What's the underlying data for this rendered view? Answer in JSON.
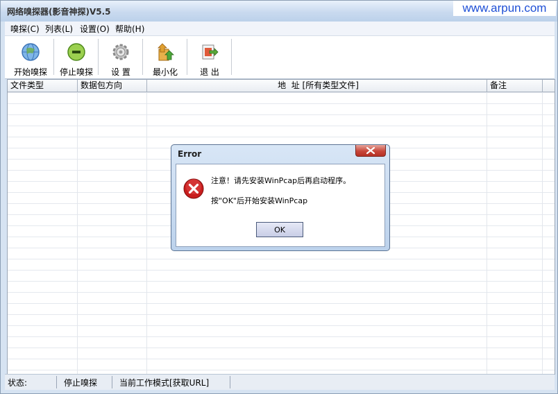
{
  "window": {
    "title": "网络嗅探器(影音神探)V5.5"
  },
  "brand": "www.arpun.com",
  "menu": [
    {
      "label": "嗅探(C)"
    },
    {
      "label": "列表(L)"
    },
    {
      "label": "设置(O)"
    },
    {
      "label": "帮助(H)"
    }
  ],
  "toolbar": [
    {
      "label": "开始嗅探",
      "icon": "globe-icon"
    },
    {
      "label": "停止嗅探",
      "icon": "stop-icon"
    },
    {
      "label": "设 置",
      "icon": "gear-icon"
    },
    {
      "label": "最小化",
      "icon": "minimize-icon"
    },
    {
      "label": "退 出",
      "icon": "exit-icon"
    }
  ],
  "table": {
    "columns": [
      "文件类型",
      "数据包方向",
      "地  址 [所有类型文件]",
      "备注"
    ]
  },
  "status": {
    "label": "状态:",
    "state": "停止嗅探",
    "mode": "当前工作模式[获取URL]"
  },
  "dialog": {
    "title": "Error",
    "message1": "注意！请先安装WinPcap后再启动程序。",
    "message2": "按\"OK\"后开始安装WinPcap",
    "ok_label": "OK",
    "icon": "error-icon"
  },
  "colors": {
    "brand": "#1e4fd6",
    "error_red": "#c81e1e",
    "close_red": "#c8473a"
  }
}
